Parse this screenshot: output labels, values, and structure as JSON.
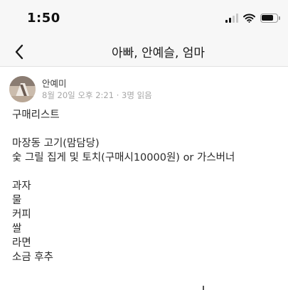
{
  "status_bar": {
    "time": "1:50",
    "signal_icon": "cellular-signal-icon",
    "wifi_icon": "wifi-icon",
    "battery_icon": "battery-icon"
  },
  "nav": {
    "back_icon": "chevron-left-icon",
    "title": "아빠, 안예슬, 엄마"
  },
  "post": {
    "author": "안예미",
    "meta": "8월 20일 오후 2:21 · 3명 읽음",
    "lines": [
      "구매리스트",
      "",
      "마장동 고기(맘담당)",
      "숯 그릴 집게 및 토치(구매시10000원)  or 가스버너",
      "",
      "과자",
      "물",
      "커피",
      "쌀",
      "라면",
      "소금 후추"
    ]
  },
  "colors": {
    "bar_background": "#f7f7f7",
    "text": "#2a2a2a",
    "meta_text": "#a6a6a6"
  }
}
